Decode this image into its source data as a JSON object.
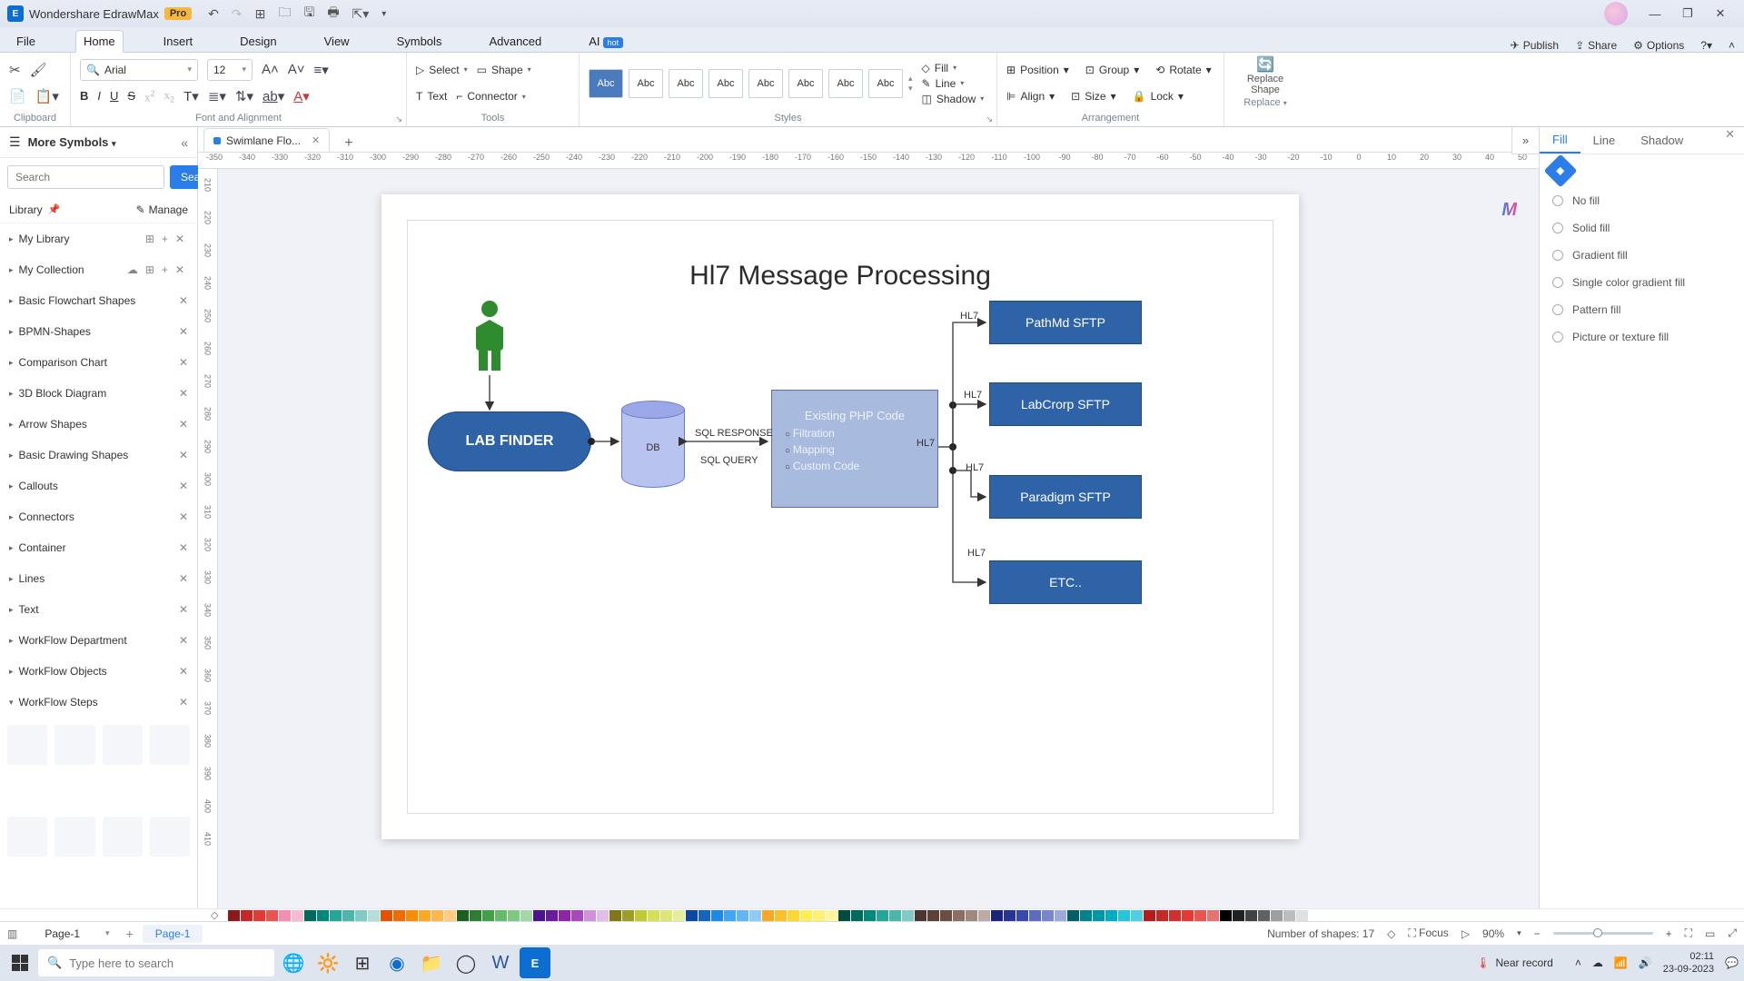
{
  "app": {
    "name": "Wondershare EdrawMax",
    "badge": "Pro"
  },
  "window": {
    "min": "—",
    "max": "❐",
    "close": "✕"
  },
  "menu": {
    "items": [
      "File",
      "Home",
      "Insert",
      "Design",
      "View",
      "Symbols",
      "Advanced",
      "AI"
    ],
    "active": "Home",
    "ai_badge": "hot",
    "right": {
      "publish": "Publish",
      "share": "Share",
      "options": "Options"
    }
  },
  "ribbon": {
    "clipboard": {
      "label": "Clipboard"
    },
    "font": {
      "family": "Arial",
      "size": "12",
      "label": "Font and Alignment"
    },
    "tools": {
      "select": "Select",
      "shape": "Shape",
      "text": "Text",
      "connector": "Connector",
      "label": "Tools"
    },
    "styles": {
      "item": "Abc",
      "label": "Styles",
      "fill": "Fill",
      "line": "Line",
      "shadow": "Shadow"
    },
    "arrange": {
      "position": "Position",
      "group": "Group",
      "rotate": "Rotate",
      "align": "Align",
      "size": "Size",
      "lock": "Lock",
      "label": "Arrangement"
    },
    "replace": {
      "main": "Replace Shape",
      "sub": "Replace"
    }
  },
  "left": {
    "title": "More Symbols",
    "search_ph": "Search",
    "search_btn": "Search",
    "library": "Library",
    "manage": "Manage",
    "mylib": "My Library",
    "mycol": "My Collection",
    "cats": [
      "Basic Flowchart Shapes",
      "BPMN-Shapes",
      "Comparison Chart",
      "3D Block Diagram",
      "Arrow Shapes",
      "Basic Drawing Shapes",
      "Callouts",
      "Connectors",
      "Container",
      "Lines",
      "Text",
      "WorkFlow Department",
      "WorkFlow Objects",
      "WorkFlow Steps"
    ]
  },
  "doc": {
    "tab": "Swimlane Flo...",
    "page": "Page-1"
  },
  "diagram": {
    "title": "Hl7 Message Processing",
    "labfinder": "LAB FINDER",
    "db": "DB",
    "php_title": "Existing PHP Code",
    "php_items": [
      "Filtration",
      "Mapping",
      "Custom Code"
    ],
    "sql_resp": "SQL RESPONSE",
    "sql_query": "SQL QUERY",
    "hl7": "HL7",
    "sftp": [
      "PathMd SFTP",
      "LabCrorp SFTP",
      "Paradigm SFTP",
      "ETC.."
    ]
  },
  "right": {
    "tabs": [
      "Fill",
      "Line",
      "Shadow"
    ],
    "opts": [
      "No fill",
      "Solid fill",
      "Gradient fill",
      "Single color gradient fill",
      "Pattern fill",
      "Picture or texture fill"
    ]
  },
  "palette": [
    "#8b1a1a",
    "#c62828",
    "#e53935",
    "#ef5350",
    "#f48fb1",
    "#f8bbd0",
    "#00695c",
    "#00897b",
    "#26a69a",
    "#4db6ac",
    "#80cbc4",
    "#b2dfdb",
    "#e65100",
    "#ef6c00",
    "#fb8c00",
    "#ffa726",
    "#ffb74d",
    "#ffcc80",
    "#1b5e20",
    "#2e7d32",
    "#43a047",
    "#66bb6a",
    "#81c784",
    "#a5d6a7",
    "#4a148c",
    "#6a1b9a",
    "#8e24aa",
    "#ab47bc",
    "#ce93d8",
    "#e1bee7",
    "#827717",
    "#9e9d24",
    "#c0ca33",
    "#d4e157",
    "#dce775",
    "#e6ee9c",
    "#0d47a1",
    "#1565c0",
    "#1e88e5",
    "#42a5f5",
    "#64b5f6",
    "#90caf9",
    "#f9a825",
    "#fbc02d",
    "#fdd835",
    "#ffee58",
    "#fff176",
    "#fff59d",
    "#004d40",
    "#00695c",
    "#00897b",
    "#26a69a",
    "#4db6ac",
    "#80cbc4",
    "#4e342e",
    "#5d4037",
    "#6d4c41",
    "#8d6e63",
    "#a1887f",
    "#bcaaa4",
    "#1a237e",
    "#283593",
    "#3949ab",
    "#5c6bc0",
    "#7986cb",
    "#9fa8da",
    "#006064",
    "#00838f",
    "#0097a7",
    "#00acc1",
    "#26c6da",
    "#4dd0e1",
    "#b71c1c",
    "#c62828",
    "#d32f2f",
    "#e53935",
    "#ef5350",
    "#e57373",
    "#000000",
    "#212121",
    "#424242",
    "#616161",
    "#9e9e9e",
    "#bdbdbd",
    "#e0e0e0",
    "#ffffff"
  ],
  "status": {
    "shapes_lbl": "Number of shapes:",
    "shapes": "17",
    "focus": "Focus",
    "zoom": "90%"
  },
  "taskbar": {
    "search_ph": "Type here to search",
    "weather": "Near record",
    "time": "02:11",
    "date": "23-09-2023"
  },
  "ruler_h": [
    "-350",
    "-340",
    "-330",
    "-320",
    "-310",
    "-300",
    "-290",
    "-280",
    "-270",
    "-260",
    "-250",
    "-240",
    "-230",
    "-220",
    "-210",
    "-200",
    "-190",
    "-180",
    "-170",
    "-160",
    "-150",
    "-140",
    "-130",
    "-120",
    "-110",
    "-100",
    "-90",
    "-80",
    "-70",
    "-60",
    "-50",
    "-40",
    "-30",
    "-20",
    "-10",
    "0",
    "10",
    "20",
    "30",
    "40",
    "50"
  ],
  "ruler_v": [
    "210",
    "220",
    "230",
    "240",
    "250",
    "260",
    "270",
    "280",
    "290",
    "300",
    "310",
    "320",
    "330",
    "340",
    "350",
    "360",
    "370",
    "380",
    "390",
    "400",
    "410"
  ]
}
